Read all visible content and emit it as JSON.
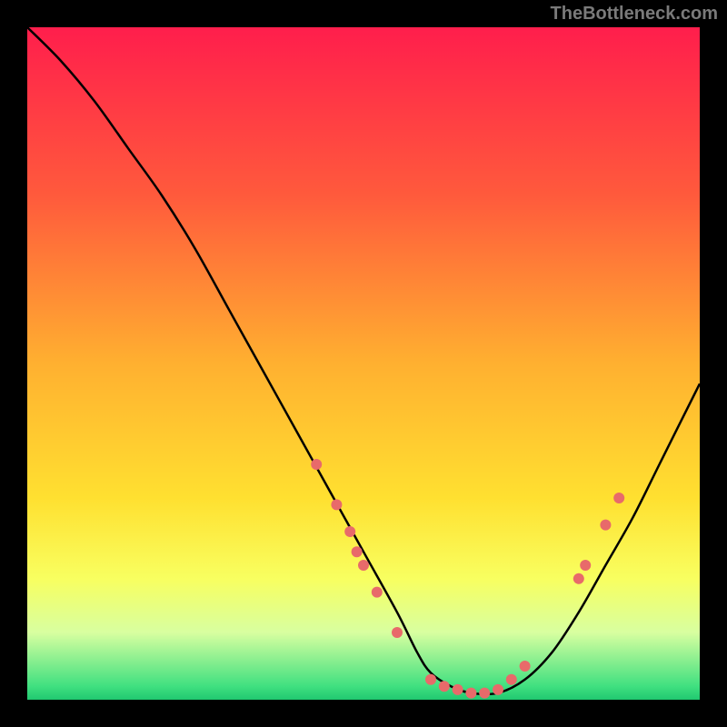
{
  "attribution": "TheBottleneck.com",
  "chart_data": {
    "type": "line",
    "title": "",
    "xlabel": "",
    "ylabel": "",
    "xlim": [
      0,
      100
    ],
    "ylim": [
      0,
      100
    ],
    "curve": {
      "x": [
        0,
        5,
        10,
        15,
        20,
        25,
        30,
        35,
        40,
        45,
        50,
        55,
        58,
        60,
        63,
        66,
        70,
        74,
        78,
        82,
        86,
        90,
        94,
        100
      ],
      "y": [
        100,
        95,
        89,
        82,
        75,
        67,
        58,
        49,
        40,
        31,
        22,
        13,
        7,
        4,
        2,
        1,
        1,
        3,
        7,
        13,
        20,
        27,
        35,
        47
      ]
    },
    "markers": [
      {
        "x": 43,
        "y": 35
      },
      {
        "x": 46,
        "y": 29
      },
      {
        "x": 48,
        "y": 25
      },
      {
        "x": 49,
        "y": 22
      },
      {
        "x": 50,
        "y": 20
      },
      {
        "x": 52,
        "y": 16
      },
      {
        "x": 55,
        "y": 10
      },
      {
        "x": 60,
        "y": 3
      },
      {
        "x": 62,
        "y": 2
      },
      {
        "x": 64,
        "y": 1.5
      },
      {
        "x": 66,
        "y": 1
      },
      {
        "x": 68,
        "y": 1
      },
      {
        "x": 70,
        "y": 1.5
      },
      {
        "x": 72,
        "y": 3
      },
      {
        "x": 74,
        "y": 5
      },
      {
        "x": 82,
        "y": 18
      },
      {
        "x": 83,
        "y": 20
      },
      {
        "x": 86,
        "y": 26
      },
      {
        "x": 88,
        "y": 30
      }
    ],
    "gradient_bands": [
      {
        "color": "#ff1e4c",
        "stop": 0
      },
      {
        "color": "#ff5a3c",
        "stop": 25
      },
      {
        "color": "#ffb030",
        "stop": 50
      },
      {
        "color": "#ffe030",
        "stop": 70
      },
      {
        "color": "#f8ff60",
        "stop": 82
      },
      {
        "color": "#d8ffa0",
        "stop": 90
      },
      {
        "color": "#40e080",
        "stop": 98
      },
      {
        "color": "#20c870",
        "stop": 100
      }
    ],
    "marker_color": "#e86a6a",
    "curve_color": "#000000"
  }
}
